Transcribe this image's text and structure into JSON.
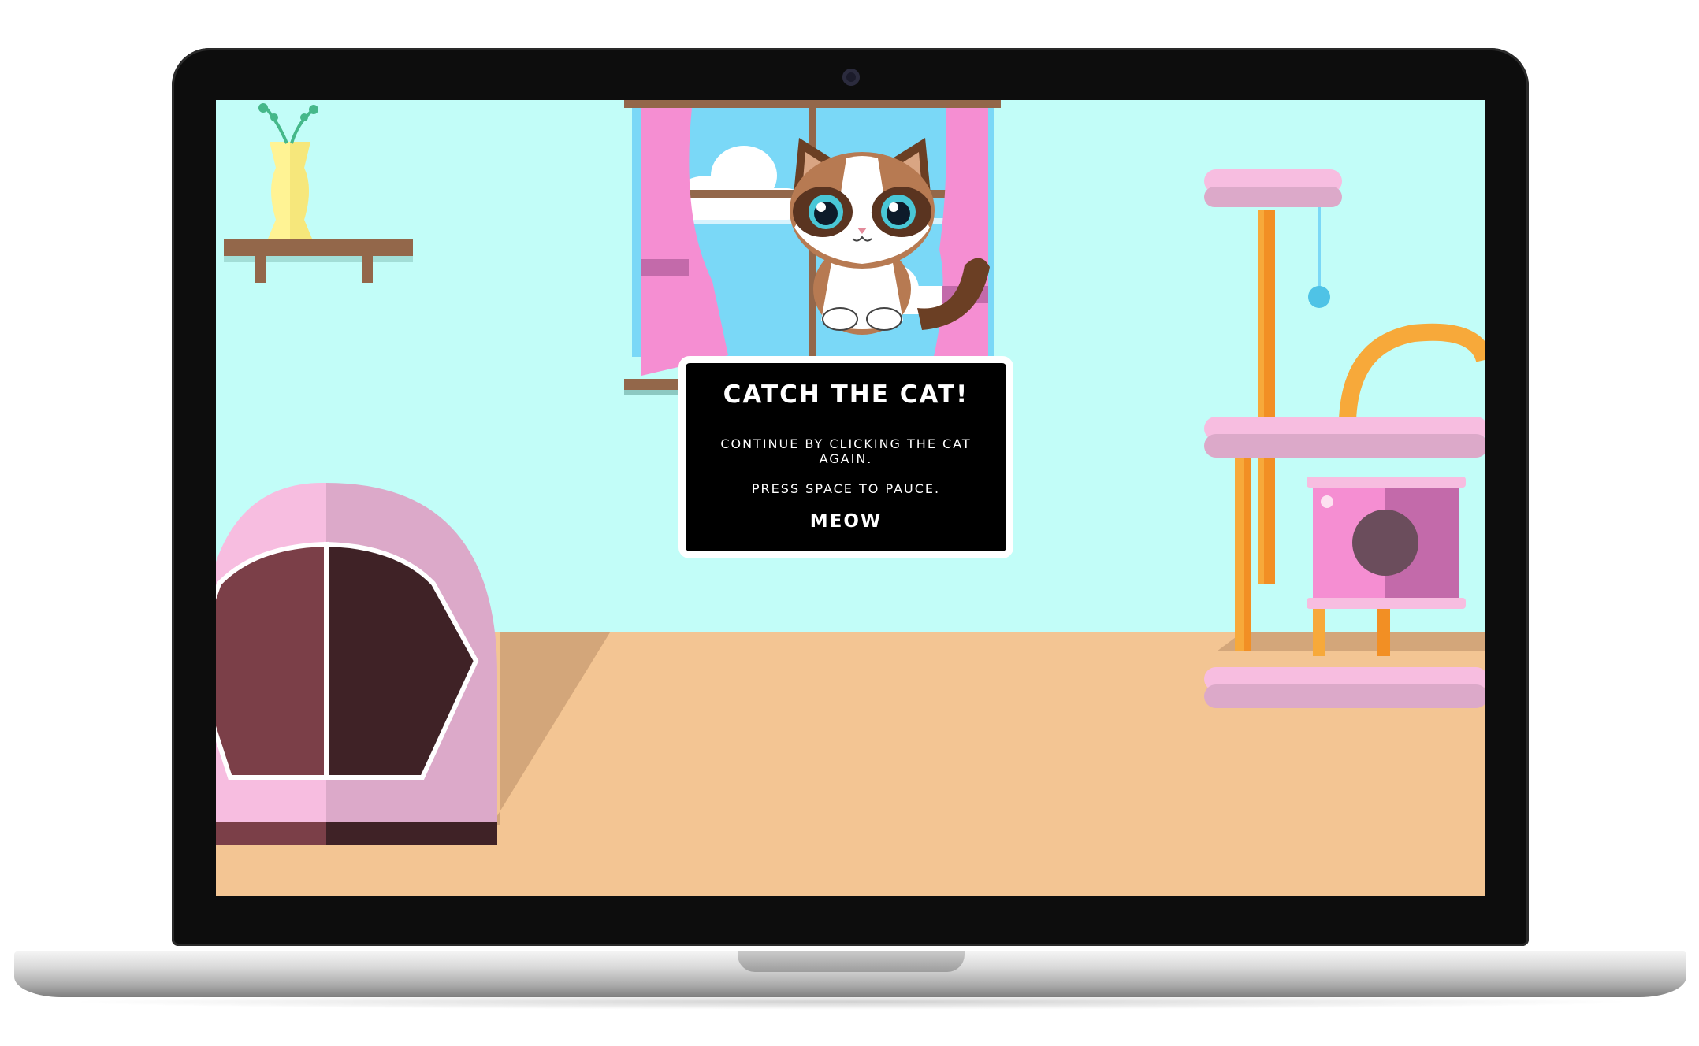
{
  "game": {
    "dialog": {
      "title": "CATCH THE CAT!",
      "line1": "CONTINUE BY CLICKING THE CAT AGAIN.",
      "line2": "PRESS SPACE TO PAUCE.",
      "button_label": "MEOW"
    }
  },
  "colors": {
    "wall": "#c2fdf8",
    "floor": "#f3c593",
    "curtain": "#f58ed2",
    "tower_post": "#f7a93a",
    "tower_platform": "#dca9c9",
    "bed_body": "#f7bde0",
    "dialog_bg": "#000000"
  }
}
